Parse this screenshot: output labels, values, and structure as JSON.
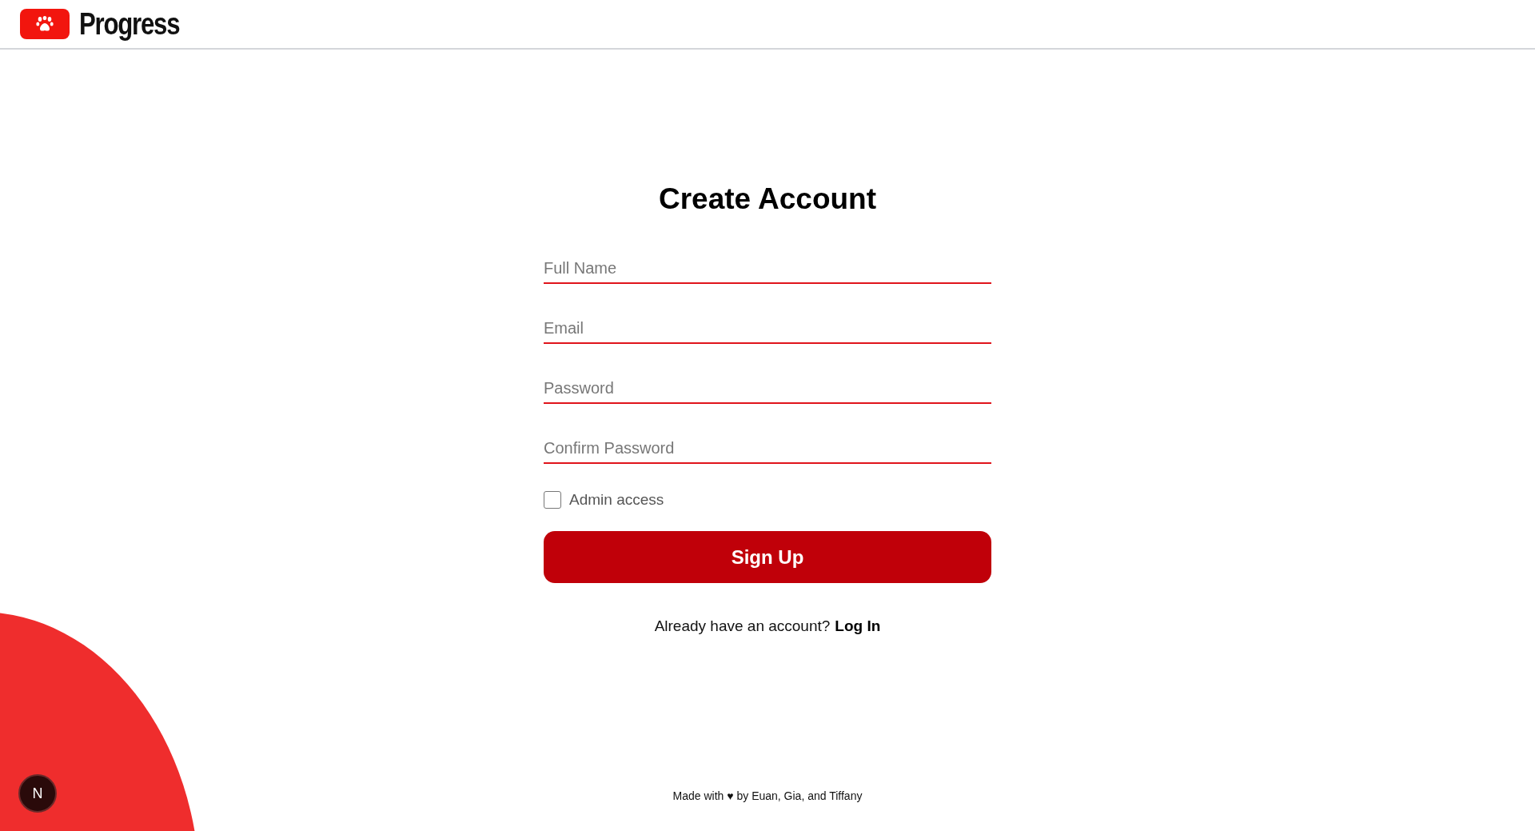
{
  "header": {
    "brand": "Progress"
  },
  "form": {
    "title": "Create Account",
    "fields": [
      {
        "placeholder": "Full Name"
      },
      {
        "placeholder": "Email"
      },
      {
        "placeholder": "Password"
      },
      {
        "placeholder": "Confirm Password"
      }
    ],
    "checkbox": {
      "label": "Admin access",
      "checked": false
    },
    "submit": "Sign Up",
    "login_prompt": "Already have an account?",
    "login_link": "Log In"
  },
  "footer": "Made with ♥ by Euan, Gia, and Tiffany",
  "dev_badge": "N"
}
